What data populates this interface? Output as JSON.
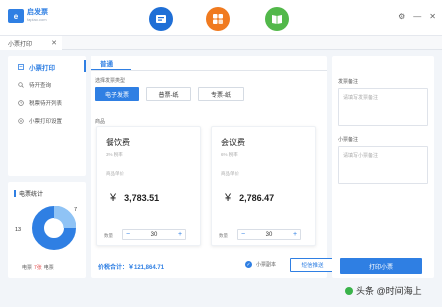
{
  "logo": {
    "name": "启发票",
    "sub": "fapiao.com"
  },
  "toolbar": {
    "icons": [
      "invoice-app-icon",
      "grid-app-icon",
      "book-app-icon"
    ]
  },
  "window": {
    "settings": "⚙",
    "minimize": "—",
    "close": "✕"
  },
  "tabs": [
    {
      "label": "小票打印",
      "close": "✕"
    }
  ],
  "sidebar": {
    "items": [
      {
        "label": "小票打印",
        "active": true
      },
      {
        "label": "待开查询"
      },
      {
        "label": "税票待开列表"
      },
      {
        "label": "小票打印设置"
      }
    ]
  },
  "stats": {
    "title": "电票统计",
    "value_a": "7",
    "value_b": "13",
    "legend_prefix": "电票",
    "legend_value": "7张",
    "legend_suffix": "电票",
    "accent": "#2f7fe3"
  },
  "main": {
    "tab": "普通",
    "type_label": "选择发票类型",
    "types": [
      "电子发票",
      "普票-纸",
      "专票-纸"
    ],
    "goods_label": "商品",
    "cards": [
      {
        "name": "餐饮费",
        "rate": "3% 税率",
        "price_label": "商品单价",
        "price": "3,783.51",
        "qty_label": "数量",
        "qty": "30"
      },
      {
        "name": "会议费",
        "rate": "6% 税率",
        "price_label": "商品单价",
        "price": "2,786.47",
        "qty_label": "数量",
        "qty": "30"
      }
    ],
    "currency": "¥",
    "total": "价税合计：￥121,864.71",
    "check_label": "小票副本",
    "send_button": "短信推送"
  },
  "right": {
    "invoice_note_label": "发票备注",
    "invoice_note_placeholder": "请填写发票备注",
    "receipt_note_label": "小票备注",
    "receipt_note_placeholder": "请填写小票备注",
    "print_button": "打印小票"
  },
  "watermark": "头条 @时间海上"
}
